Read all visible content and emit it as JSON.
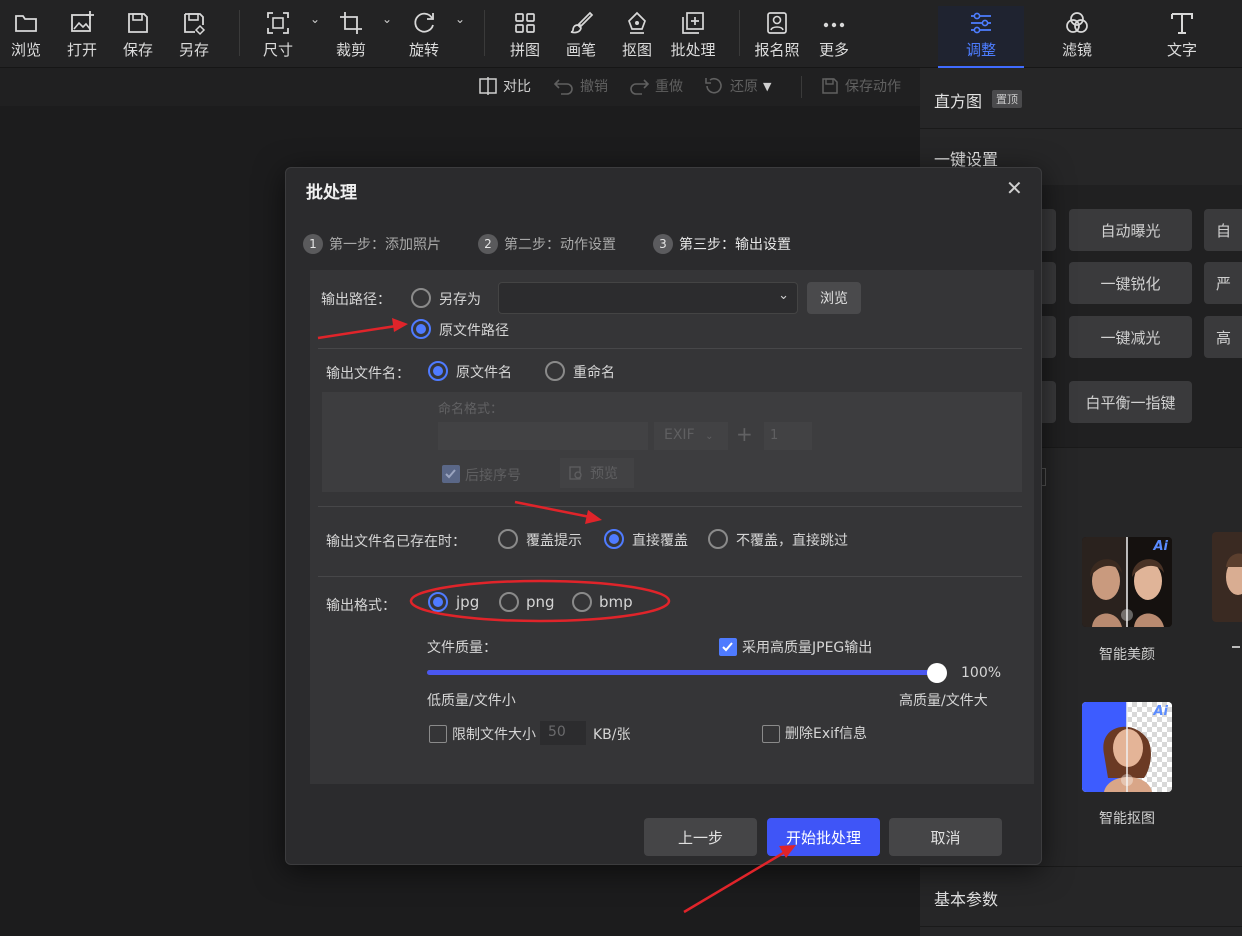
{
  "toolbar": {
    "browse": "浏览",
    "open": "打开",
    "save": "保存",
    "save_as": "另存",
    "size": "尺寸",
    "crop": "裁剪",
    "rotate": "旋转",
    "collage": "拼图",
    "brush": "画笔",
    "cutout": "抠图",
    "batch": "批处理",
    "id_photo": "报名照",
    "more": "更多"
  },
  "subbar": {
    "compare": "对比",
    "undo": "撤销",
    "redo": "重做",
    "restore": "还原",
    "save_action": "保存动作"
  },
  "right_panel": {
    "tabs": [
      "调整",
      "滤镜",
      "文字"
    ],
    "histogram": "直方图",
    "pin_badge": "置顶",
    "one_click_settings": "一键设置",
    "buttons": [
      "自动曝光",
      "一键锐化",
      "一键减光",
      "白平衡一指键"
    ],
    "cut_buttons": [
      "自",
      "严",
      "高"
    ],
    "ai_badge": "Ai",
    "features": [
      "智能美颜",
      "智能抠图"
    ],
    "basic_params": "基本参数",
    "accent_color": "#3f6bff"
  },
  "dialog": {
    "title": "批处理",
    "steps": [
      {
        "num": "1",
        "label": "第一步：添加照片"
      },
      {
        "num": "2",
        "label": "第二步：动作设置"
      },
      {
        "num": "3",
        "label": "第三步：输出设置"
      }
    ],
    "output_path": {
      "label": "输出路径：",
      "option_save_as": "另存为",
      "option_original": "原文件路径",
      "path_value": "",
      "browse_button": "浏览",
      "selected": "原文件路径"
    },
    "output_filename": {
      "label": "输出文件名：",
      "option_original": "原文件名",
      "option_rename": "重命名",
      "selected": "原文件名",
      "naming_format_label": "命名格式：",
      "exif_select": "EXIF",
      "plus": "+",
      "start_number": "1",
      "append_seq_label": "后接序号",
      "append_seq_checked": true,
      "preview_button": "预览"
    },
    "exists": {
      "label": "输出文件名已存在时：",
      "options": [
        "覆盖提示",
        "直接覆盖",
        "不覆盖，直接跳过"
      ],
      "selected": "直接覆盖"
    },
    "format": {
      "label": "输出格式：",
      "options": [
        "jpg",
        "png",
        "bmp"
      ],
      "selected": "jpg"
    },
    "quality": {
      "label": "文件质量：",
      "hq_jpeg_label": "采用高质量JPEG输出",
      "hq_jpeg_checked": true,
      "value": 1.0,
      "value_text": "100%",
      "low_label": "低质量/文件小",
      "high_label": "高质量/文件大"
    },
    "limit_size": {
      "label": "限制文件大小",
      "checked": false,
      "value": "50",
      "unit": "KB/张"
    },
    "delete_exif": {
      "label": "删除Exif信息",
      "checked": false
    },
    "buttons": {
      "prev": "上一步",
      "start": "开始批处理",
      "cancel": "取消"
    },
    "close": "✕",
    "annotation_color": "#e0242a"
  }
}
